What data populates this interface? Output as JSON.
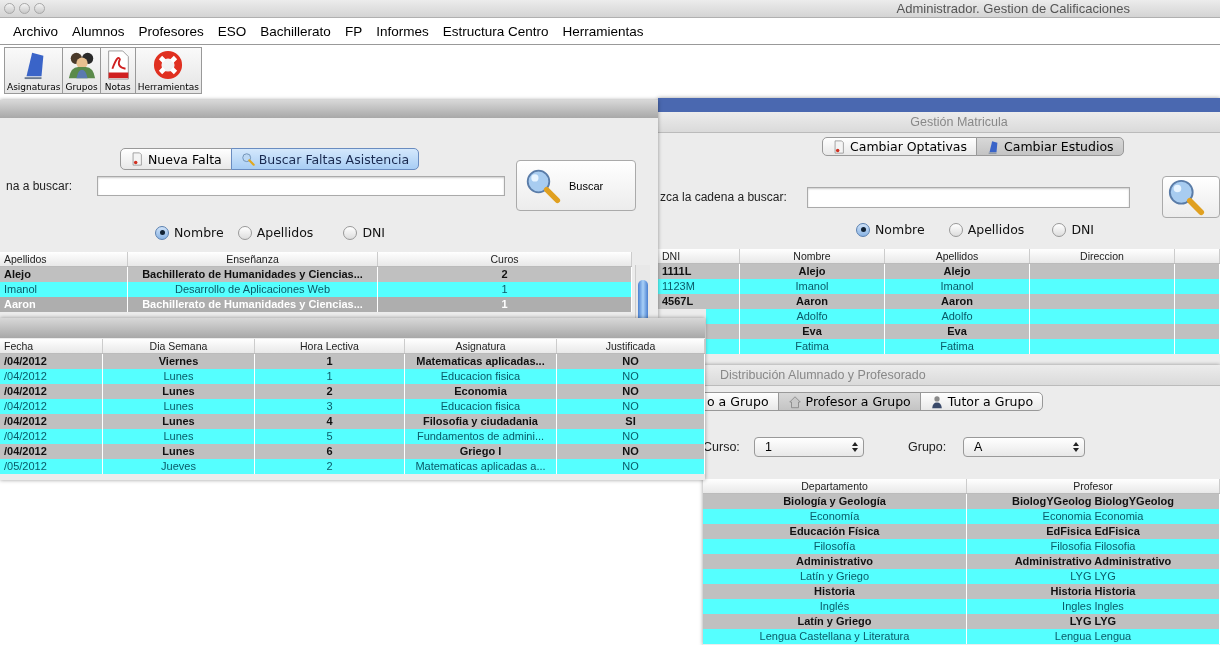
{
  "window": {
    "title": "Administrador. Gestion de Calificaciones"
  },
  "menu": [
    "Archivo",
    "Alumnos",
    "Profesores",
    "ESO",
    "Bachillerato",
    "FP",
    "Informes",
    "Estructura Centro",
    "Herramientas"
  ],
  "toolbar": [
    {
      "label": "Asignaturas",
      "kind": "book"
    },
    {
      "label": "Grupos",
      "kind": "people"
    },
    {
      "label": "Notas",
      "kind": "pdf"
    },
    {
      "label": "Herramientas",
      "kind": "lifebuoy"
    }
  ],
  "faltas_window": {
    "tabs": [
      {
        "label": "Nueva Falta",
        "kind": "document",
        "selected": false
      },
      {
        "label": "Buscar Faltas Asistencia",
        "kind": "search",
        "selected": true
      }
    ],
    "search_label": "na a buscar:",
    "search_button": "Buscar",
    "radios": [
      {
        "label": "Nombre",
        "checked": true
      },
      {
        "label": "Apellidos",
        "checked": false
      },
      {
        "label": "DNI",
        "checked": false
      }
    ],
    "table": {
      "columns": [
        "Apellidos",
        "Enseñanza",
        "Curos"
      ],
      "rows": [
        {
          "cells": [
            "Alejo",
            "Bachillerato de Humanidades y Ciencias...",
            "2"
          ],
          "selected": false
        },
        {
          "cells": [
            "Imanol",
            "Desarrollo de Aplicaciones Web",
            "1"
          ],
          "selected": false
        },
        {
          "cells": [
            "Aaron",
            "Bachillerato de Humanidades y Ciencias...",
            "1"
          ],
          "selected": true
        }
      ]
    }
  },
  "matricula_window": {
    "title": "Gestión Matricula",
    "tabs": [
      {
        "label": "Cambiar Optativas",
        "kind": "document",
        "selected": false
      },
      {
        "label": "Cambiar Estudios",
        "kind": "book",
        "selected": true
      }
    ],
    "search_label": "zca la cadena a buscar:",
    "radios": [
      {
        "label": "Nombre",
        "checked": true
      },
      {
        "label": "Apellidos",
        "checked": false
      },
      {
        "label": "DNI",
        "checked": false
      }
    ],
    "table": {
      "columns": [
        "DNI",
        "Nombre",
        "Apellidos",
        "Direccion"
      ],
      "rows": [
        {
          "dni": "1111L",
          "nombre": "Alejo",
          "apellidos": "Alejo",
          "selected": false
        },
        {
          "dni": "1123M",
          "nombre": "Imanol",
          "apellidos": "Imanol",
          "selected": false
        },
        {
          "dni": "4567L",
          "nombre": "Aaron",
          "apellidos": "Aaron",
          "selected": false
        },
        {
          "nombre": "Adolfo",
          "apellidos": "Adolfo",
          "selected": false
        },
        {
          "nombre": "Eva",
          "apellidos": "Eva",
          "selected": false
        },
        {
          "nombre": "Fatima",
          "apellidos": "Fatima",
          "selected": false
        }
      ]
    }
  },
  "distribucion_window": {
    "title": "Distribución Alumnado y Profesorado",
    "tabs": [
      {
        "label": "o a Grupo",
        "kind": "none",
        "selected": false
      },
      {
        "label": "Profesor a Grupo",
        "kind": "house",
        "selected": true
      },
      {
        "label": "Tutor a Grupo",
        "kind": "person",
        "selected": false
      }
    ],
    "curso": {
      "label": "Curso:",
      "value": "1"
    },
    "grupo": {
      "label": "Grupo:",
      "value": "A"
    },
    "table": {
      "columns": [
        "Departamento",
        "Profesor"
      ],
      "rows": [
        {
          "cells": [
            "Biología y Geología",
            "BiologYGeolog BiologYGeolog"
          ],
          "selected": false
        },
        {
          "cells": [
            "Economía",
            "Economia Economia"
          ],
          "selected": false
        },
        {
          "cells": [
            "Educación Física",
            "EdFisica EdFisica"
          ],
          "selected": false
        },
        {
          "cells": [
            "Filosofía",
            "Filosofia Filosofia"
          ],
          "selected": false
        },
        {
          "cells": [
            "Administrativo",
            "Administrativo Administrativo"
          ],
          "selected": false
        },
        {
          "cells": [
            "Latín y Griego",
            "LYG LYG"
          ],
          "selected": false
        },
        {
          "cells": [
            "Historia",
            "Historia Historia"
          ],
          "selected": false
        },
        {
          "cells": [
            "Inglés",
            "Ingles Ingles"
          ],
          "selected": false
        },
        {
          "cells": [
            "Latín y Griego",
            "LYG LYG"
          ],
          "selected": false
        },
        {
          "cells": [
            "Lengua Castellana y Literatura",
            "Lengua Lengua"
          ],
          "selected": false
        }
      ]
    }
  },
  "faltas_table_window": {
    "table": {
      "columns": [
        "Fecha",
        "Dia Semana",
        "Hora Lectiva",
        "Asignatura",
        "Justificada"
      ],
      "rows": [
        {
          "cells": [
            "/04/2012",
            "Viernes",
            "1",
            "Matematicas aplicadas...",
            "NO"
          ],
          "selected": false
        },
        {
          "cells": [
            "/04/2012",
            "Lunes",
            "1",
            "Educacion fisica",
            "NO"
          ],
          "selected": false
        },
        {
          "cells": [
            "/04/2012",
            "Lunes",
            "2",
            "Economia",
            "NO"
          ],
          "selected": false
        },
        {
          "cells": [
            "/04/2012",
            "Lunes",
            "3",
            "Educacion fisica",
            "NO"
          ],
          "selected": false
        },
        {
          "cells": [
            "/04/2012",
            "Lunes",
            "4",
            "Filosofia y ciudadania",
            "SI"
          ],
          "selected": false
        },
        {
          "cells": [
            "/04/2012",
            "Lunes",
            "5",
            "Fundamentos de admini...",
            "NO"
          ],
          "selected": false
        },
        {
          "cells": [
            "/04/2012",
            "Lunes",
            "6",
            "Griego I",
            "NO"
          ],
          "selected": false
        },
        {
          "cells": [
            "/05/2012",
            "Jueves",
            "2",
            "Matematicas aplicadas a...",
            "NO"
          ],
          "selected": false
        }
      ]
    }
  }
}
